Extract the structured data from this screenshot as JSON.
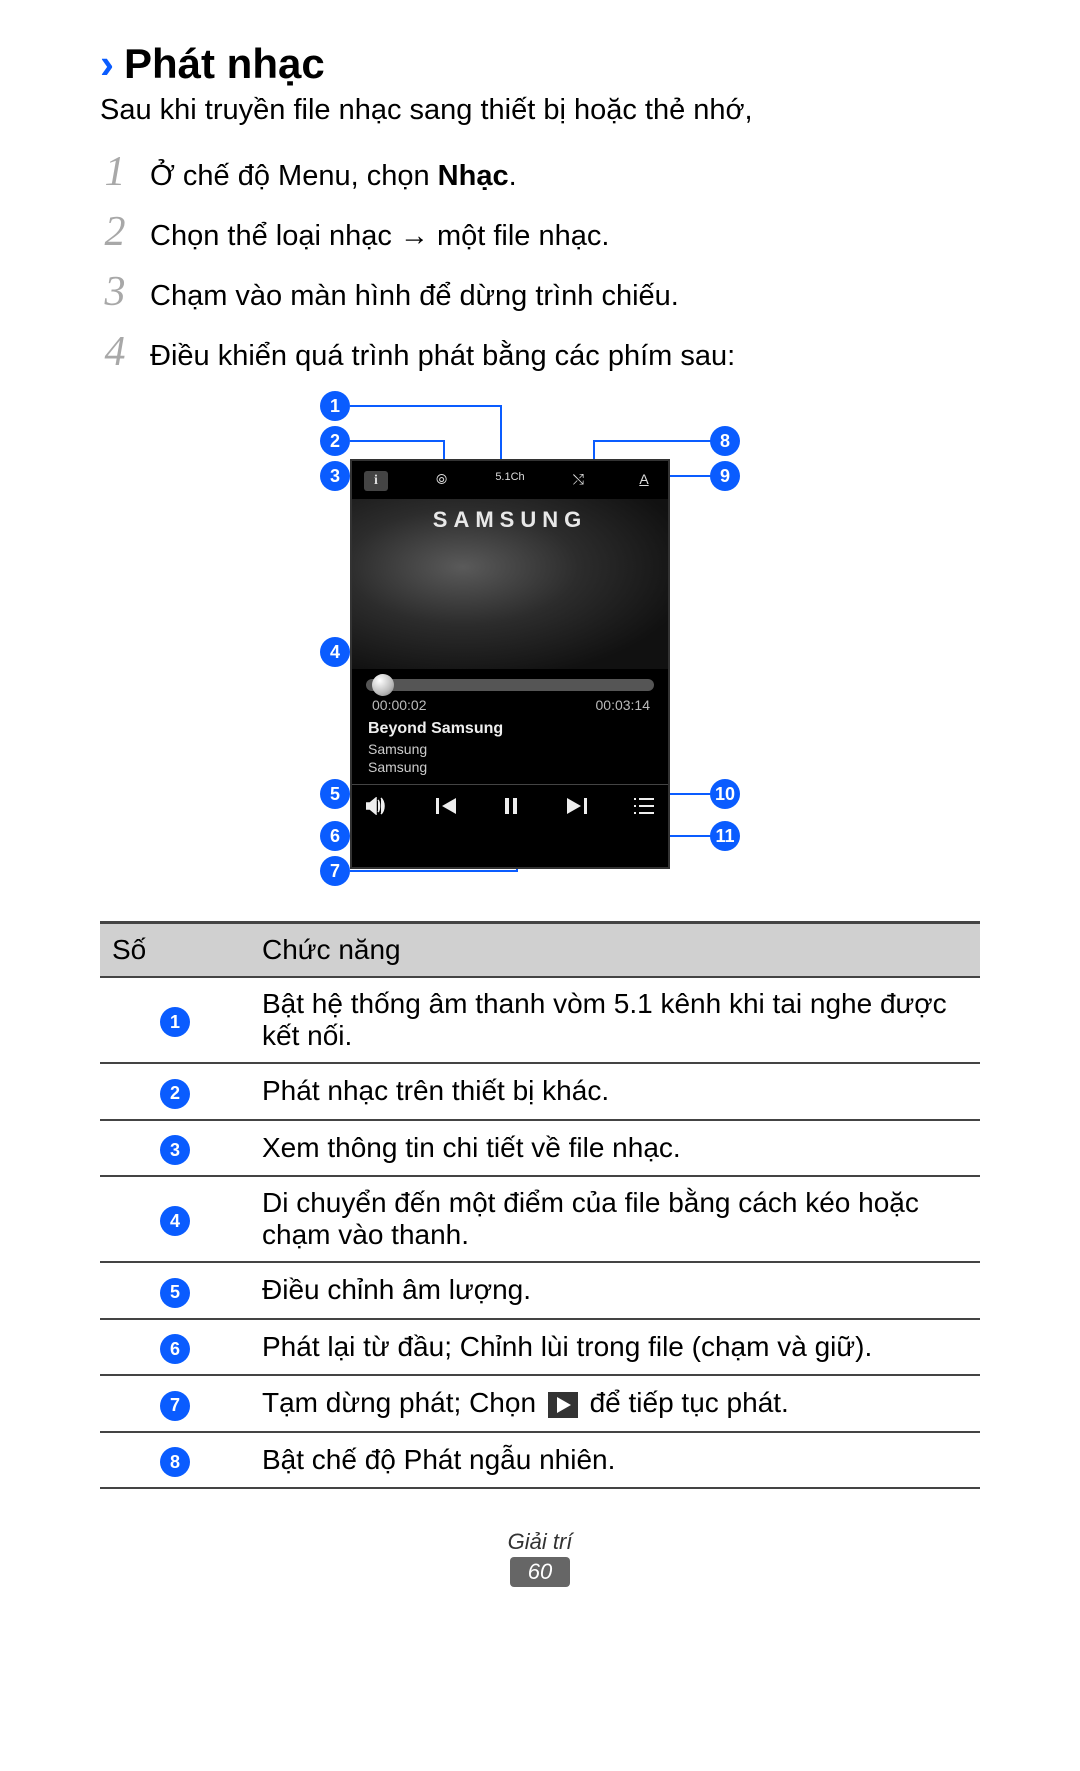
{
  "heading": "Phát nhạc",
  "intro": "Sau khi truyền file nhạc sang thiết bị hoặc thẻ nhớ,",
  "steps": [
    {
      "num": "1",
      "prefix": "Ở chế độ Menu, chọn ",
      "bold": "Nhạc",
      "suffix": "."
    },
    {
      "num": "2",
      "prefix": "Chọn thể loại nhạc → một file nhạc.",
      "bold": "",
      "suffix": ""
    },
    {
      "num": "3",
      "prefix": "Chạm vào màn hình để dừng trình chiếu.",
      "bold": "",
      "suffix": ""
    },
    {
      "num": "4",
      "prefix": "Điều khiển quá trình phát bằng các phím sau:",
      "bold": "",
      "suffix": ""
    }
  ],
  "player": {
    "topbar": {
      "info": "i",
      "cast": "⦾",
      "surround": "5.1Ch",
      "shuffle": "⤭",
      "repeat": "A"
    },
    "brand": "SAMSUNG",
    "time_elapsed": "00:00:02",
    "time_total": "00:03:14",
    "track_title": "Beyond Samsung",
    "artist": "Samsung",
    "album": "Samsung"
  },
  "callouts": {
    "1": "1",
    "2": "2",
    "3": "3",
    "4": "4",
    "5": "5",
    "6": "6",
    "7": "7",
    "8": "8",
    "9": "9",
    "10": "10",
    "11": "11"
  },
  "table": {
    "header_num": "Số",
    "header_func": "Chức năng",
    "rows": [
      {
        "n": "1",
        "text": "Bật hệ thống âm thanh vòm 5.1 kênh khi tai nghe được kết nối."
      },
      {
        "n": "2",
        "text": "Phát nhạc trên thiết bị khác."
      },
      {
        "n": "3",
        "text": "Xem thông tin chi tiết về file nhạc."
      },
      {
        "n": "4",
        "text": "Di chuyển đến một điểm của file bằng cách kéo hoặc chạm vào thanh."
      },
      {
        "n": "5",
        "text": "Điều chỉnh âm lượng."
      },
      {
        "n": "6",
        "text": "Phát lại từ đầu; Chỉnh lùi trong file (chạm và giữ)."
      },
      {
        "n": "7",
        "text_a": "Tạm dừng phát; Chọn ",
        "text_b": " để tiếp tục phát.",
        "has_play": true
      },
      {
        "n": "8",
        "text": "Bật chế độ Phát ngẫu nhiên."
      }
    ]
  },
  "footer": {
    "category": "Giải trí",
    "page": "60"
  }
}
